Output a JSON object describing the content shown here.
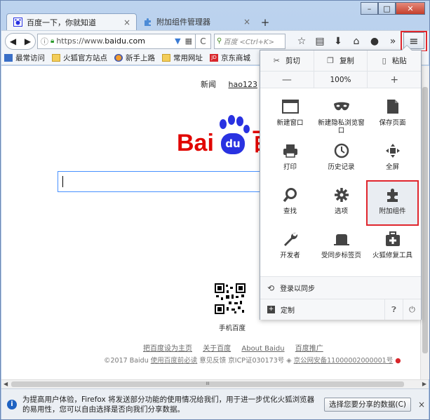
{
  "window": {
    "min_glyph": "–",
    "max_glyph": "□",
    "close_glyph": "✕"
  },
  "tabs": [
    {
      "title": "百度一下，你就知道",
      "close": "×"
    },
    {
      "title": "附加组件管理器",
      "close": "×"
    }
  ],
  "newtab_glyph": "+",
  "nav": {
    "back": "◀",
    "forward": "▶",
    "url_prefix": "https://www.",
    "url_host": "baidu.com",
    "reload": "C",
    "search_placeholder": "百度 <Ctrl+K>",
    "menu_glyph": "≡"
  },
  "bookmarks": [
    {
      "label": "最常访问",
      "icon": "blue"
    },
    {
      "label": "火狐官方站点",
      "icon": "folder"
    },
    {
      "label": "新手上路",
      "icon": "firefox"
    },
    {
      "label": "常用网址",
      "icon": "folder"
    },
    {
      "label": "京东商城",
      "icon": "jd",
      "icon_text": "JD"
    }
  ],
  "page": {
    "topnav": [
      "新闻",
      "hao123"
    ],
    "logo_left": "Bai",
    "logo_paw": "du",
    "logo_right": "百",
    "qr_label": "手机百度",
    "footer_links": [
      "把百度设为主页",
      "关于百度",
      "About Baidu",
      "百度推广"
    ],
    "footer2_a": "©2017 Baidu ",
    "footer2_b": "使用百度前必读",
    "footer2_c": " 意见反馈 京ICP证030173号 ",
    "footer2_d": "京公网安备11000002000001号"
  },
  "menu": {
    "cut": "剪切",
    "copy": "复制",
    "paste": "粘贴",
    "zoom_out": "—",
    "zoom_level": "100%",
    "zoom_in": "+",
    "items": [
      {
        "label": "新建窗口",
        "icon": "window-icon"
      },
      {
        "label": "新建隐私浏览窗口",
        "icon": "mask-icon"
      },
      {
        "label": "保存页面",
        "icon": "save-page-icon"
      },
      {
        "label": "打印",
        "icon": "printer-icon"
      },
      {
        "label": "历史记录",
        "icon": "history-icon"
      },
      {
        "label": "全屏",
        "icon": "fullscreen-icon"
      },
      {
        "label": "查找",
        "icon": "find-icon"
      },
      {
        "label": "选项",
        "icon": "gear-icon"
      },
      {
        "label": "附加组件",
        "icon": "puzzle-icon"
      },
      {
        "label": "开发者",
        "icon": "wrench-icon"
      },
      {
        "label": "受同步标签页",
        "icon": "synced-tabs-icon"
      },
      {
        "label": "火狐修复工具",
        "icon": "repair-icon"
      }
    ],
    "sync": "登录以同步",
    "customize": "定制"
  },
  "hscroll_grip": "III",
  "notification": {
    "message": "为提高用户体验，Firefox 将发送部分功能的使用情况给我们，用于进一步优化火狐浏览器的易用性，您可以自由选择是否向我们分享数据。",
    "button": "选择您要分享的数据(C)",
    "close": "×"
  }
}
